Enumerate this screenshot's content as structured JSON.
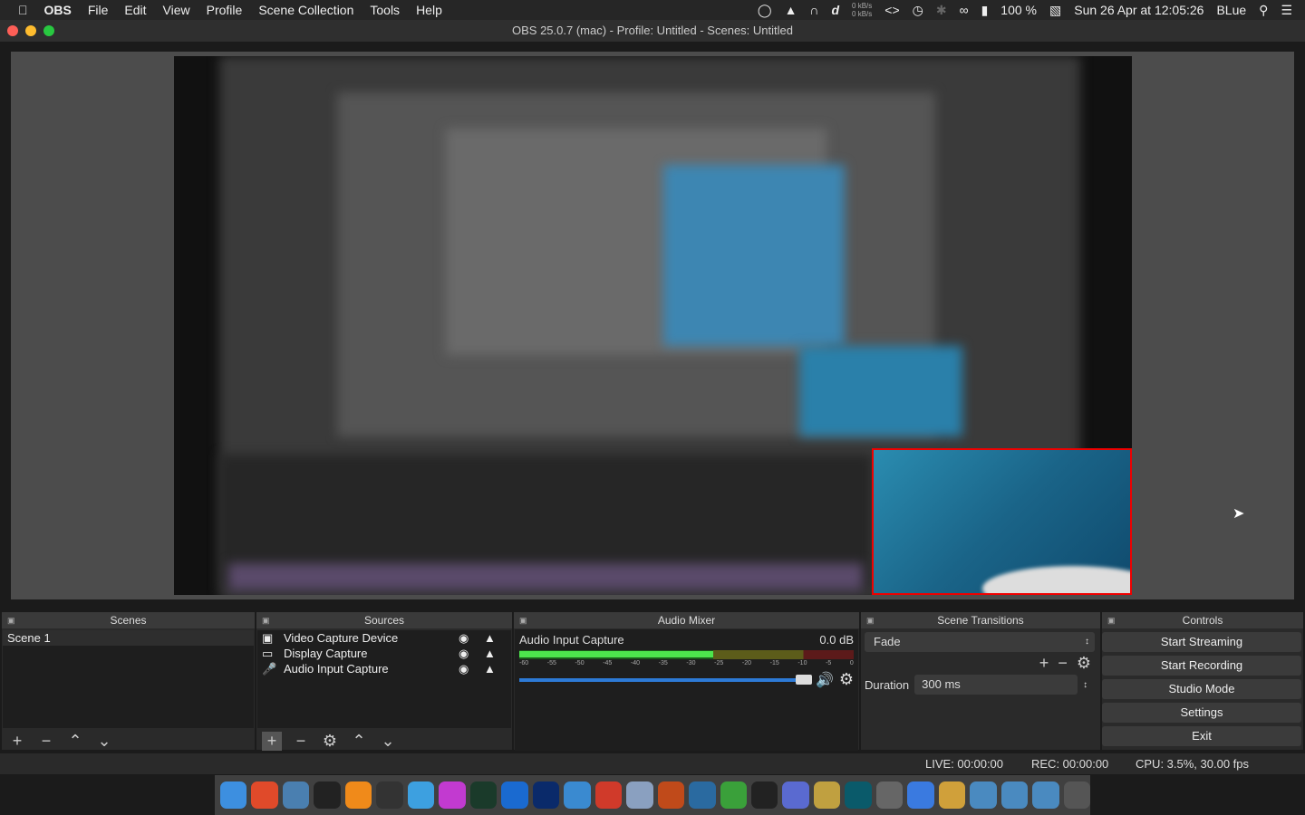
{
  "menubar": {
    "items": [
      "File",
      "Edit",
      "View",
      "Profile",
      "Scene Collection",
      "Tools",
      "Help"
    ],
    "app": "OBS",
    "net_up": "0 kB/s",
    "net_down": "0 kB/s",
    "battery": "100 %",
    "datetime": "Sun 26 Apr at  12:05:26",
    "user": "BLue"
  },
  "window": {
    "title": "OBS 25.0.7 (mac) - Profile: Untitled - Scenes: Untitled"
  },
  "scenes": {
    "title": "Scenes",
    "items": [
      "Scene 1"
    ]
  },
  "sources": {
    "title": "Sources",
    "items": [
      {
        "name": "Video Capture Device",
        "icon": "camera-icon"
      },
      {
        "name": "Display Capture",
        "icon": "monitor-icon"
      },
      {
        "name": "Audio Input Capture",
        "icon": "microphone-icon"
      }
    ]
  },
  "mixer": {
    "title": "Audio Mixer",
    "channel": "Audio Input Capture",
    "level": "0.0 dB",
    "meter_fill_percent": 58,
    "volume_percent": 100,
    "ticks": [
      "-60",
      "-55",
      "-50",
      "-45",
      "-40",
      "-35",
      "-30",
      "-25",
      "-20",
      "-15",
      "-10",
      "-5",
      "0"
    ]
  },
  "transitions": {
    "title": "Scene Transitions",
    "selected": "Fade",
    "duration_label": "Duration",
    "duration": "300 ms"
  },
  "controls": {
    "title": "Controls",
    "buttons": [
      "Start Streaming",
      "Start Recording",
      "Studio Mode",
      "Settings",
      "Exit"
    ]
  },
  "status": {
    "live": "LIVE: 00:00:00",
    "rec": "REC: 00:00:00",
    "cpu": "CPU: 3.5%, 30.00 fps"
  },
  "colors": {
    "selection_border": "#e00000",
    "volume_slider": "#2d7ad6",
    "meter_green": "#4de64d"
  }
}
